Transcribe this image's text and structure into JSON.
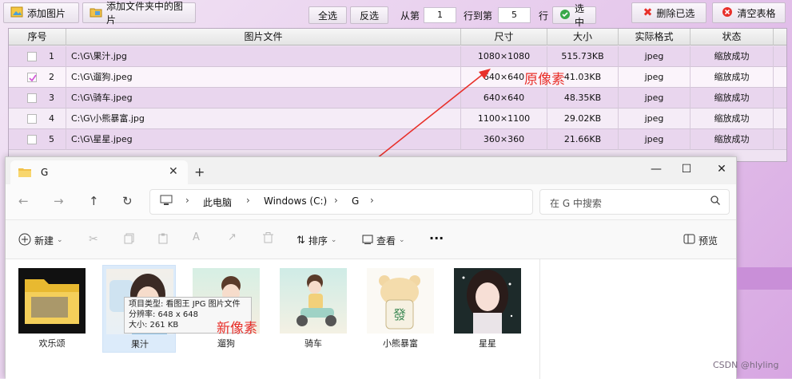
{
  "toolbar": {
    "add_image": "添加图片",
    "add_folder_images": "添加文件夹中的图片",
    "select_all": "全选",
    "invert": "反选",
    "from_label": "从第",
    "from_value": "1",
    "to_label": "行到第",
    "to_value": "5",
    "row_label": "行",
    "select_range": "选中",
    "delete_selected": "删除已选",
    "clear_table": "清空表格"
  },
  "table": {
    "headers": [
      "序号",
      "图片文件",
      "尺寸",
      "大小",
      "实际格式",
      "状态"
    ],
    "rows": [
      {
        "num": "1",
        "file": "C:\\G\\果汁.jpg",
        "size": "1080×1080",
        "bytes": "515.73KB",
        "format": "jpeg",
        "status": "缩放成功",
        "checked": false
      },
      {
        "num": "2",
        "file": "C:\\G\\遛狗.jpeg",
        "size": "640×640",
        "bytes": "41.03KB",
        "format": "jpeg",
        "status": "缩放成功",
        "checked": true
      },
      {
        "num": "3",
        "file": "C:\\G\\骑车.jpeg",
        "size": "640×640",
        "bytes": "48.35KB",
        "format": "jpeg",
        "status": "缩放成功",
        "checked": false
      },
      {
        "num": "4",
        "file": "C:\\G\\小熊暴富.jpg",
        "size": "1100×1100",
        "bytes": "29.02KB",
        "format": "jpeg",
        "status": "缩放成功",
        "checked": false
      },
      {
        "num": "5",
        "file": "C:\\G\\星星.jpeg",
        "size": "360×360",
        "bytes": "21.66KB",
        "format": "jpeg",
        "status": "缩放成功",
        "checked": false
      }
    ]
  },
  "annotations": {
    "original_pixels": "原像素",
    "new_pixels": "新像素",
    "arrow_color": "#e8302a"
  },
  "explorer": {
    "tab_title": "G",
    "breadcrumb": [
      "此电脑",
      "Windows (C:)",
      "G"
    ],
    "search_placeholder": "在 G 中搜索",
    "new_label": "新建",
    "sort_label": "排序",
    "view_label": "查看",
    "more_label": "···",
    "preview_label": "预览",
    "files": [
      "欢乐颂",
      "果汁",
      "遛狗",
      "骑车",
      "小熊暴富",
      "星星"
    ],
    "tooltip": {
      "type": "项目类型: 看图王 JPG 图片文件",
      "resolution": "分辨率: 648 x 648",
      "size": "大小: 261 KB"
    }
  },
  "watermark": "CSDN @hlyling",
  "colors": {
    "accent_red": "#e8302a",
    "row_odd": "#e9d6ee",
    "row_even": "#f5ecf7",
    "check_pink": "#d35ad8"
  }
}
